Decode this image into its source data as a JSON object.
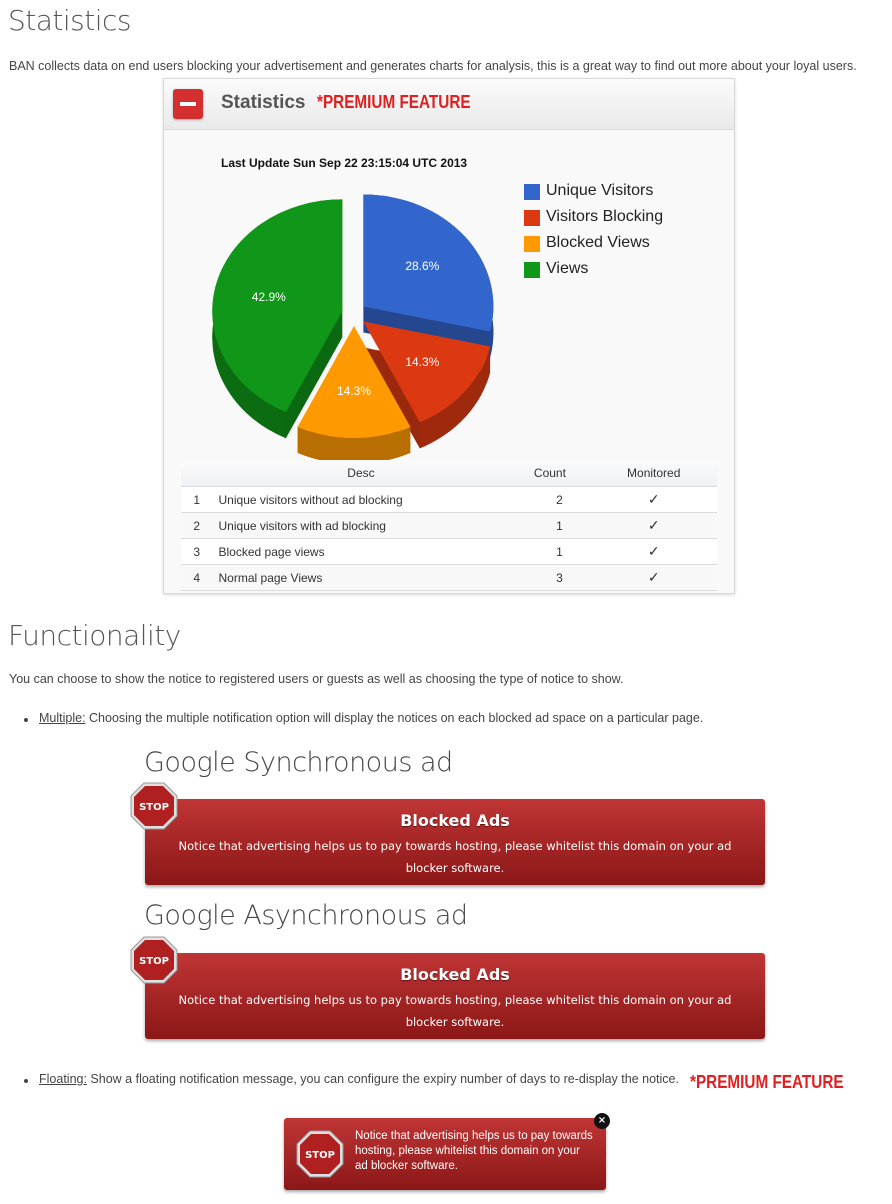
{
  "statistics": {
    "heading": "Statistics",
    "intro": "BAN collects data on end users blocking your advertisement and generates charts for analysis, this is a great way to find out more about your loyal users.",
    "panel": {
      "title": "Statistics",
      "premium_label": "*PREMIUM FEATURE",
      "last_update": "Last Update Sun Sep 22 23:15:04 UTC 2013",
      "colors": {
        "unique": "#3366cc",
        "blocking": "#dc3912",
        "blocked_views": "#ff9900",
        "views": "#109618"
      }
    },
    "table": {
      "headers": [
        "Desc",
        "Count",
        "Monitored"
      ],
      "rows": [
        {
          "num": "1",
          "desc": "Unique visitors without ad blocking",
          "count": "2",
          "monitored": "✓"
        },
        {
          "num": "2",
          "desc": "Unique visitors with ad blocking",
          "count": "1",
          "monitored": "✓"
        },
        {
          "num": "3",
          "desc": "Blocked page views",
          "count": "1",
          "monitored": "✓"
        },
        {
          "num": "4",
          "desc": "Normal page Views",
          "count": "3",
          "monitored": "✓"
        }
      ]
    }
  },
  "chart_data": {
    "type": "pie",
    "categories": [
      "Unique Visitors",
      "Visitors Blocking",
      "Blocked Views",
      "Views"
    ],
    "values": [
      2,
      1,
      1,
      3
    ],
    "labels": [
      "28.6%",
      "14.3%",
      "14.3%",
      "42.9%"
    ],
    "colors": [
      "#3366cc",
      "#dc3912",
      "#ff9900",
      "#109618"
    ],
    "legend": "right",
    "style": "3d-exploded"
  },
  "functionality": {
    "heading": "Functionality",
    "intro": "You can choose to show the notice to registered users or guests as well as choosing the type of notice to show.",
    "multiple": {
      "link": "Multiple:",
      "text": " Choosing the multiple notification option will display the notices on each blocked ad space on a particular page."
    },
    "sync_ad_title": "Google Synchronous ad",
    "async_ad_title": "Google Asynchronous ad",
    "notice": {
      "stop_label": "STOP",
      "title": "Blocked Ads",
      "message": "Notice that advertising helps us to pay towards hosting, please whitelist this domain on your ad blocker software."
    },
    "floating": {
      "link": "Floating:",
      "text": " Show a floating notification message, you can configure the expiry number of days to re-display the notice.",
      "premium_label": "*PREMIUM FEATURE",
      "stop_label": "STOP",
      "message": "Notice that advertising helps us to pay towards hosting, please whitelist this domain on your ad blocker software.",
      "close_icon": "×"
    }
  }
}
